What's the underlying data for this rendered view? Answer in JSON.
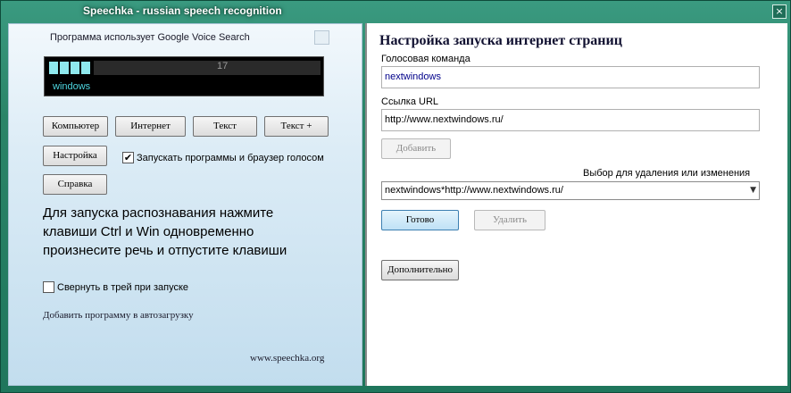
{
  "window": {
    "title": "Speechka - russian speech recognition",
    "close_symbol": "×"
  },
  "left": {
    "voice_note": "Программа использует Google Voice Search",
    "meter": {
      "level_segments": 4,
      "value": "17",
      "recognized_word": "windows",
      "level_color": "#8fe9ee"
    },
    "buttons": {
      "computer": "Компьютер",
      "internet": "Интернет",
      "text": "Текст",
      "text_plus": "Текст +",
      "settings": "Настройка",
      "help": "Справка"
    },
    "autostart_checkbox": {
      "label": "Запускать программы и браузер голосом",
      "checked": true
    },
    "instructions": "Для запуска распознавания нажмите клавиши Ctrl и Win одновременно произнесите речь и отпустите клавиши",
    "tray_checkbox": {
      "label": "Свернуть в трей при запуске",
      "checked": false
    },
    "autoload_link": "Добавить программу в автозагрузку",
    "site_link": "www.speechka.org"
  },
  "right": {
    "title": "Настройка запуска интернет страниц",
    "command_label": "Голосовая команда",
    "command_value": "nextwindows",
    "url_label": "Ссылка URL",
    "url_value": "http://www.nextwindows.ru/",
    "add_button": "Добавить",
    "select_label": "Выбор  для удаления или изменения",
    "select_value": "nextwindows*http://www.nextwindows.ru/",
    "done_button": "Готово",
    "delete_button": "Удалить",
    "more_button": "Дополнительно"
  },
  "icons": {
    "close": "close-icon",
    "check": "checkmark-icon",
    "dropdown": "chevron-down-icon"
  },
  "colors": {
    "title_bar": "#2a8468",
    "accent_button": "#bfe1f6",
    "meter_background": "#000000"
  }
}
